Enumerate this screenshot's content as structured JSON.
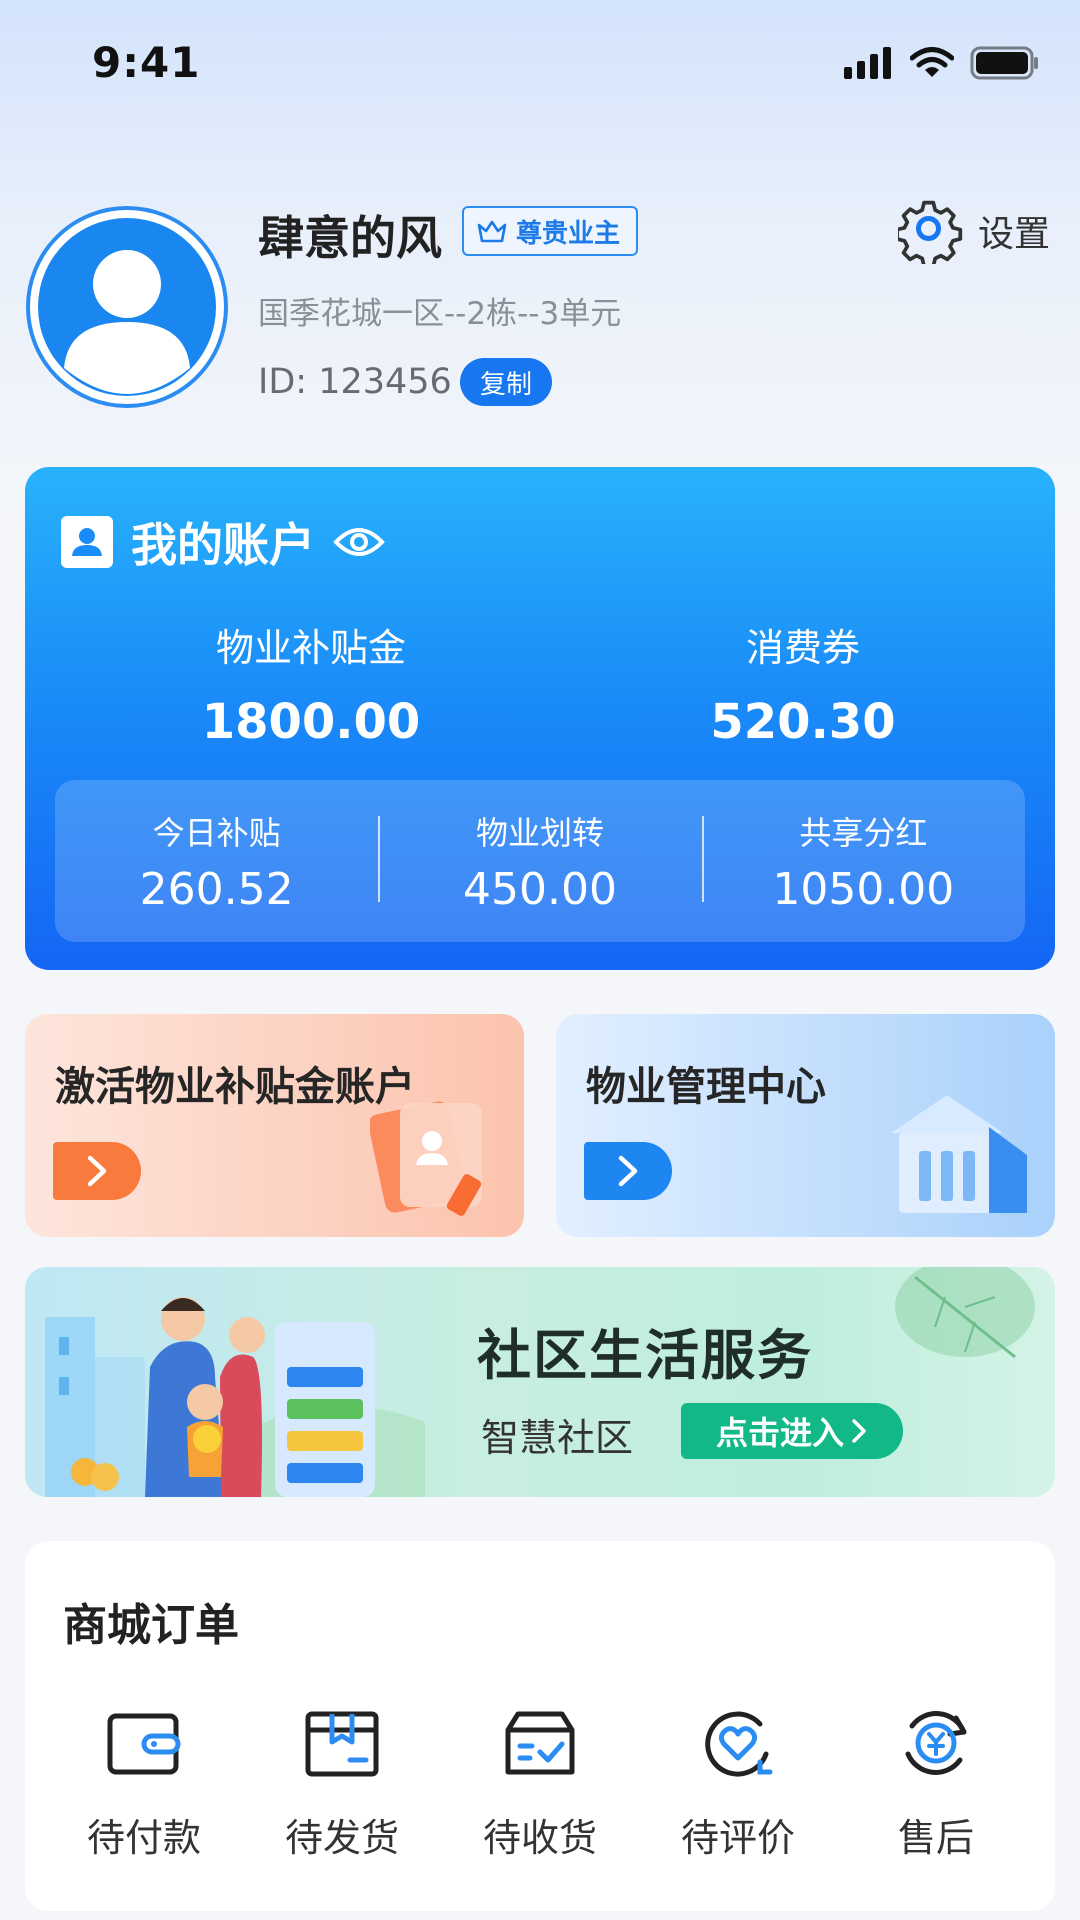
{
  "status_bar": {
    "time": "9:41"
  },
  "profile": {
    "name": "肆意的风",
    "badge": "尊贵业主",
    "address": "国季花城一区--2栋--3单元",
    "id_text": "ID: 123456",
    "copy_label": "复制",
    "settings_label": "设置"
  },
  "account": {
    "title": "我的账户",
    "subsidy_label": "物业补贴金",
    "subsidy_value": "1800.00",
    "voucher_label": "消费券",
    "voucher_value": "520.30",
    "stats": [
      {
        "label": "今日补贴",
        "value": "260.52"
      },
      {
        "label": "物业划转",
        "value": "450.00"
      },
      {
        "label": "共享分红",
        "value": "1050.00"
      }
    ]
  },
  "features": {
    "activate_title": "激活物业补贴金账户",
    "manage_title": "物业管理中心"
  },
  "banner": {
    "title": "社区生活服务",
    "subtitle": "智慧社区",
    "button": "点击进入"
  },
  "orders": {
    "title": "商城订单",
    "items": [
      {
        "label": "待付款",
        "icon": "wallet-icon"
      },
      {
        "label": "待发货",
        "icon": "box-icon"
      },
      {
        "label": "待收货",
        "icon": "receive-icon"
      },
      {
        "label": "待评价",
        "icon": "heart-review-icon"
      },
      {
        "label": "售后",
        "icon": "refund-icon"
      }
    ]
  },
  "colors": {
    "primary": "#1677f0",
    "orange": "#f87a3c",
    "green": "#12b887"
  }
}
